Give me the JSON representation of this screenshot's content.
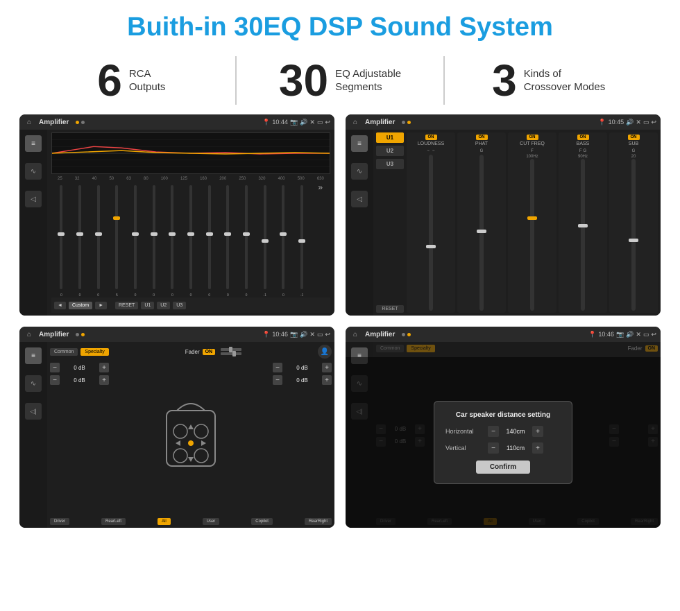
{
  "header": {
    "title": "Buith-in 30EQ DSP Sound System"
  },
  "stats": [
    {
      "number": "6",
      "label_line1": "RCA",
      "label_line2": "Outputs"
    },
    {
      "number": "30",
      "label_line1": "EQ Adjustable",
      "label_line2": "Segments"
    },
    {
      "number": "3",
      "label_line1": "Kinds of",
      "label_line2": "Crossover Modes"
    }
  ],
  "screens": [
    {
      "id": "screen1",
      "bar_title": "Amplifier",
      "bar_time": "10:44",
      "eq_freqs": [
        "25",
        "32",
        "40",
        "50",
        "63",
        "80",
        "100",
        "125",
        "160",
        "200",
        "250",
        "320",
        "400",
        "500",
        "630"
      ],
      "eq_values": [
        "0",
        "0",
        "0",
        "5",
        "0",
        "0",
        "0",
        "0",
        "0",
        "0",
        "0",
        "-1",
        "0",
        "-1"
      ],
      "preset_label": "Custom",
      "buttons": [
        "RESET",
        "U1",
        "U2",
        "U3"
      ]
    },
    {
      "id": "screen2",
      "bar_title": "Amplifier",
      "bar_time": "10:45",
      "presets": [
        "U1",
        "U2",
        "U3"
      ],
      "controls": [
        {
          "label": "LOUDNESS",
          "on": true
        },
        {
          "label": "PHAT",
          "on": true
        },
        {
          "label": "CUT FREQ",
          "on": true
        },
        {
          "label": "BASS",
          "on": true
        },
        {
          "label": "SUB",
          "on": true
        }
      ],
      "reset_label": "RESET"
    },
    {
      "id": "screen3",
      "bar_title": "Amplifier",
      "bar_time": "10:46",
      "tab_common": "Common",
      "tab_specialty": "Specialty",
      "fader_label": "Fader",
      "fader_on": "ON",
      "db_values": [
        "0 dB",
        "0 dB",
        "0 dB",
        "0 dB"
      ],
      "buttons": [
        "Driver",
        "RearLeft",
        "All",
        "User",
        "Copilot",
        "RearRight"
      ]
    },
    {
      "id": "screen4",
      "bar_title": "Amplifier",
      "bar_time": "10:46",
      "tab_common": "Common",
      "tab_specialty": "Specialty",
      "dialog": {
        "title": "Car speaker distance setting",
        "horizontal_label": "Horizontal",
        "horizontal_value": "140cm",
        "vertical_label": "Vertical",
        "vertical_value": "110cm",
        "confirm_label": "Confirm"
      },
      "db_values": [
        "0 dB",
        "0 dB"
      ],
      "buttons": [
        "Driver",
        "RearLeft",
        "All",
        "User",
        "Copilot",
        "RearRight"
      ]
    }
  ]
}
